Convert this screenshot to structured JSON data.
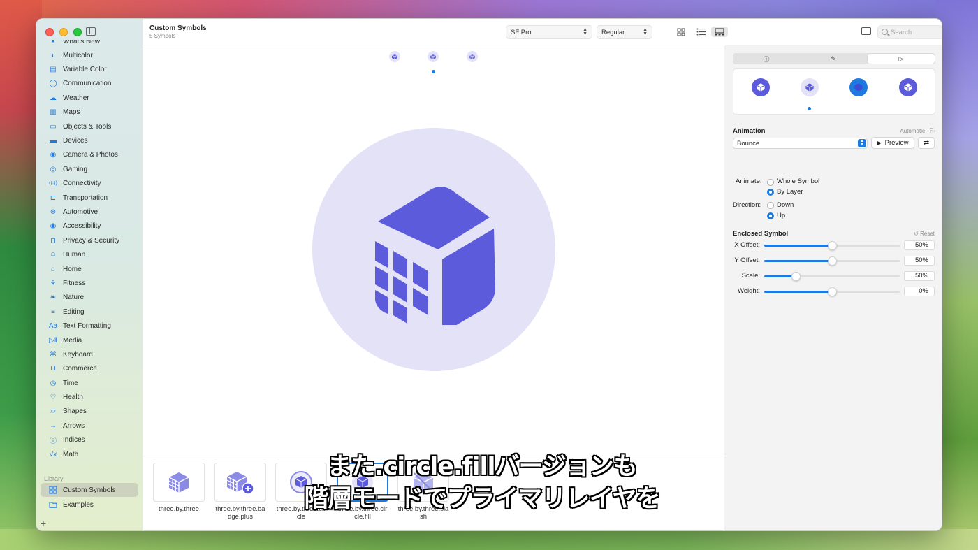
{
  "window": {
    "title": "Custom Symbols",
    "subtitle": "5 Symbols"
  },
  "toolbar": {
    "font_popup": "SF Pro",
    "weight_popup": "Regular",
    "search_placeholder": "Search",
    "active_view": "gallery"
  },
  "sidebar": {
    "items": [
      {
        "label": "What's New",
        "icon": "sparkle-icon"
      },
      {
        "label": "Multicolor",
        "icon": "palette-icon"
      },
      {
        "label": "Variable Color",
        "icon": "variable-color-icon"
      },
      {
        "label": "Communication",
        "icon": "message-bubble-icon"
      },
      {
        "label": "Weather",
        "icon": "cloud-icon"
      },
      {
        "label": "Maps",
        "icon": "map-icon"
      },
      {
        "label": "Objects & Tools",
        "icon": "folder-icon"
      },
      {
        "label": "Devices",
        "icon": "display-icon"
      },
      {
        "label": "Camera & Photos",
        "icon": "camera-icon"
      },
      {
        "label": "Gaming",
        "icon": "gamecontroller-icon"
      },
      {
        "label": "Connectivity",
        "icon": "antenna-icon"
      },
      {
        "label": "Transportation",
        "icon": "car-icon"
      },
      {
        "label": "Automotive",
        "icon": "steering-wheel-icon"
      },
      {
        "label": "Accessibility",
        "icon": "accessibility-icon"
      },
      {
        "label": "Privacy & Security",
        "icon": "lock-icon"
      },
      {
        "label": "Human",
        "icon": "person-icon"
      },
      {
        "label": "Home",
        "icon": "house-icon"
      },
      {
        "label": "Fitness",
        "icon": "figure-run-icon"
      },
      {
        "label": "Nature",
        "icon": "leaf-icon"
      },
      {
        "label": "Editing",
        "icon": "slider-icon"
      },
      {
        "label": "Text Formatting",
        "icon": "textformat-icon"
      },
      {
        "label": "Media",
        "icon": "play-pause-icon"
      },
      {
        "label": "Keyboard",
        "icon": "command-icon"
      },
      {
        "label": "Commerce",
        "icon": "cart-icon"
      },
      {
        "label": "Time",
        "icon": "clock-icon"
      },
      {
        "label": "Health",
        "icon": "heart-icon"
      },
      {
        "label": "Shapes",
        "icon": "shapes-icon"
      },
      {
        "label": "Arrows",
        "icon": "arrow-icon"
      },
      {
        "label": "Indices",
        "icon": "indices-icon"
      },
      {
        "label": "Math",
        "icon": "math-icon"
      }
    ],
    "library_header": "Library",
    "library": [
      {
        "label": "Custom Symbols",
        "icon": "grid-icon",
        "selected": true
      },
      {
        "label": "Examples",
        "icon": "folder-icon",
        "selected": false
      }
    ],
    "add_label": "+"
  },
  "gallery": {
    "tiles": [
      {
        "name": "three.by.three"
      },
      {
        "name": "three.by.three.badge.plus"
      },
      {
        "name": "three.by.three.circle"
      },
      {
        "name": "three.by.three.circle.fill",
        "selected": true
      },
      {
        "name": "three.by.three.slash"
      }
    ]
  },
  "caption": {
    "line1": "また.circle.fillバージョンも",
    "line2": "階層モードでプライマリレイヤを"
  },
  "inspector": {
    "tabs": [
      "info",
      "paintbrush",
      "play"
    ],
    "active_tab": "play",
    "animation": {
      "title": "Animation",
      "automatic_label": "Automatic",
      "effect": "Bounce",
      "preview_label": "Preview"
    },
    "animate": {
      "label": "Animate:",
      "options": [
        "Whole Symbol",
        "By Layer"
      ],
      "selected": "By Layer"
    },
    "direction": {
      "label": "Direction:",
      "options": [
        "Down",
        "Up"
      ],
      "selected": "Up"
    },
    "enclosed": {
      "title": "Enclosed Symbol",
      "reset_label": "Reset",
      "sliders": [
        {
          "label": "X Offset:",
          "value": "50%",
          "fraction": 0.5
        },
        {
          "label": "Y Offset:",
          "value": "50%",
          "fraction": 0.5
        },
        {
          "label": "Scale:",
          "value": "50%",
          "fraction": 0.23
        },
        {
          "label": "Weight:",
          "value": "0%",
          "fraction": 0.5
        }
      ]
    }
  },
  "colors": {
    "accent": "#1f7ae0",
    "symbol": "#5b5bdc",
    "symbol_bg": "#e3e2f6"
  }
}
